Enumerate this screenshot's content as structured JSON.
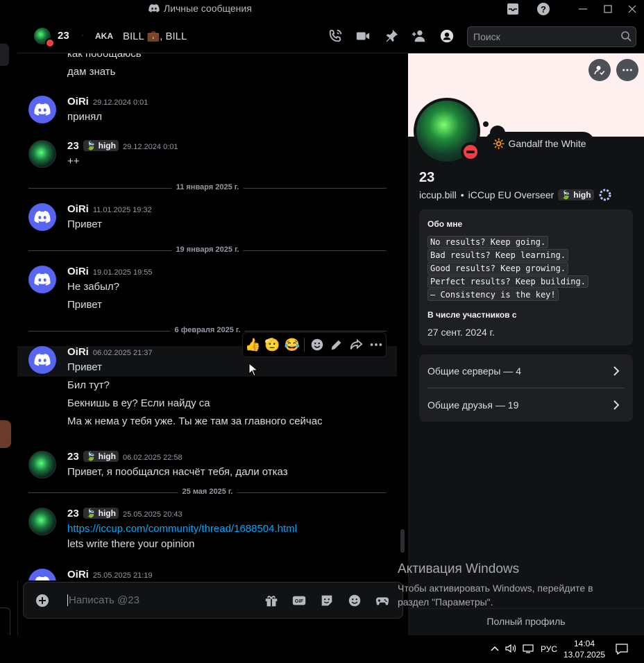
{
  "window": {
    "title": "Личные сообщения",
    "controls": [
      "inbox-icon",
      "help-icon",
      "minimize-icon",
      "maximize-icon",
      "close-icon"
    ]
  },
  "header": {
    "username": "23",
    "separator": "·",
    "aka_label": "AKA",
    "nicknames": "BILL 💼, BILL",
    "search_placeholder": "Поиск"
  },
  "messages": [
    {
      "lines": [
        "как пообщаюсь",
        "дам знать"
      ]
    },
    {
      "user": "OiRi",
      "timestamp": "29.12.2024 0:01",
      "lines": [
        "принял"
      ]
    },
    {
      "user": "23",
      "tag": "high",
      "timestamp": "29.12.2024 0:01",
      "lines": [
        "++"
      ]
    },
    {
      "divider": "11 января 2025 г."
    },
    {
      "user": "OiRi",
      "timestamp": "11.01.2025 19:32",
      "lines": [
        "Привет"
      ]
    },
    {
      "divider": "19 января 2025 г."
    },
    {
      "user": "OiRi",
      "timestamp": "19.01.2025 19:55",
      "lines": [
        "Не забыл?",
        "Привет"
      ]
    },
    {
      "divider": "6 февраля 2025 г."
    },
    {
      "user": "OiRi",
      "timestamp": "06.02.2025 21:37",
      "lines": [
        "Привет",
        "Бил тут?",
        "Бекнишь в еу? Если найду са",
        "Ма ж нема у тебя уже. Ты же там за главного сейчас"
      ]
    },
    {
      "user": "23",
      "tag": "high",
      "timestamp": "06.02.2025 22:58",
      "lines": [
        "Привет, я пообщался насчёт тебя, дали отказ"
      ]
    },
    {
      "divider": "25 мая 2025 г."
    },
    {
      "user": "23",
      "tag": "high",
      "timestamp": "25.05.2025 20:43",
      "link": "https://iccup.com/community/thread/1688504.html",
      "lines": [
        "lets write there your opinion"
      ]
    },
    {
      "user": "OiRi",
      "timestamp": "25.05.2025 21:19"
    }
  ],
  "reactions_toolbar": [
    "👍",
    "🫡",
    "😂"
  ],
  "composer": {
    "placeholder": "Написать @23"
  },
  "profile": {
    "status_emoji": "🔆",
    "status_text": "Gandalf the White",
    "name": "23",
    "handle": "iccup.bill",
    "bullet": "•",
    "guild": "iCCup EU Overseer",
    "tag": "high",
    "about_title": "Обо мне",
    "about_lines": [
      "No results? Keep going.",
      "Bad results? Keep learning.",
      "Good results? Keep growing.",
      "Perfect results? Keep building.",
      "— Consistency is the key!"
    ],
    "member_since_title": "В числе участников с",
    "member_since": "27 сент. 2024 г.",
    "mutual_servers": "Общие серверы — 4",
    "mutual_friends": "Общие друзья — 19",
    "full_profile": "Полный профиль"
  },
  "activation": {
    "title": "Активация Windows",
    "line1": "Чтобы активировать Windows, перейдите в",
    "line2": "раздел \"Параметры\"."
  },
  "taskbar": {
    "lang": "РУС",
    "time": "14:04",
    "date": "13.07.2025"
  }
}
